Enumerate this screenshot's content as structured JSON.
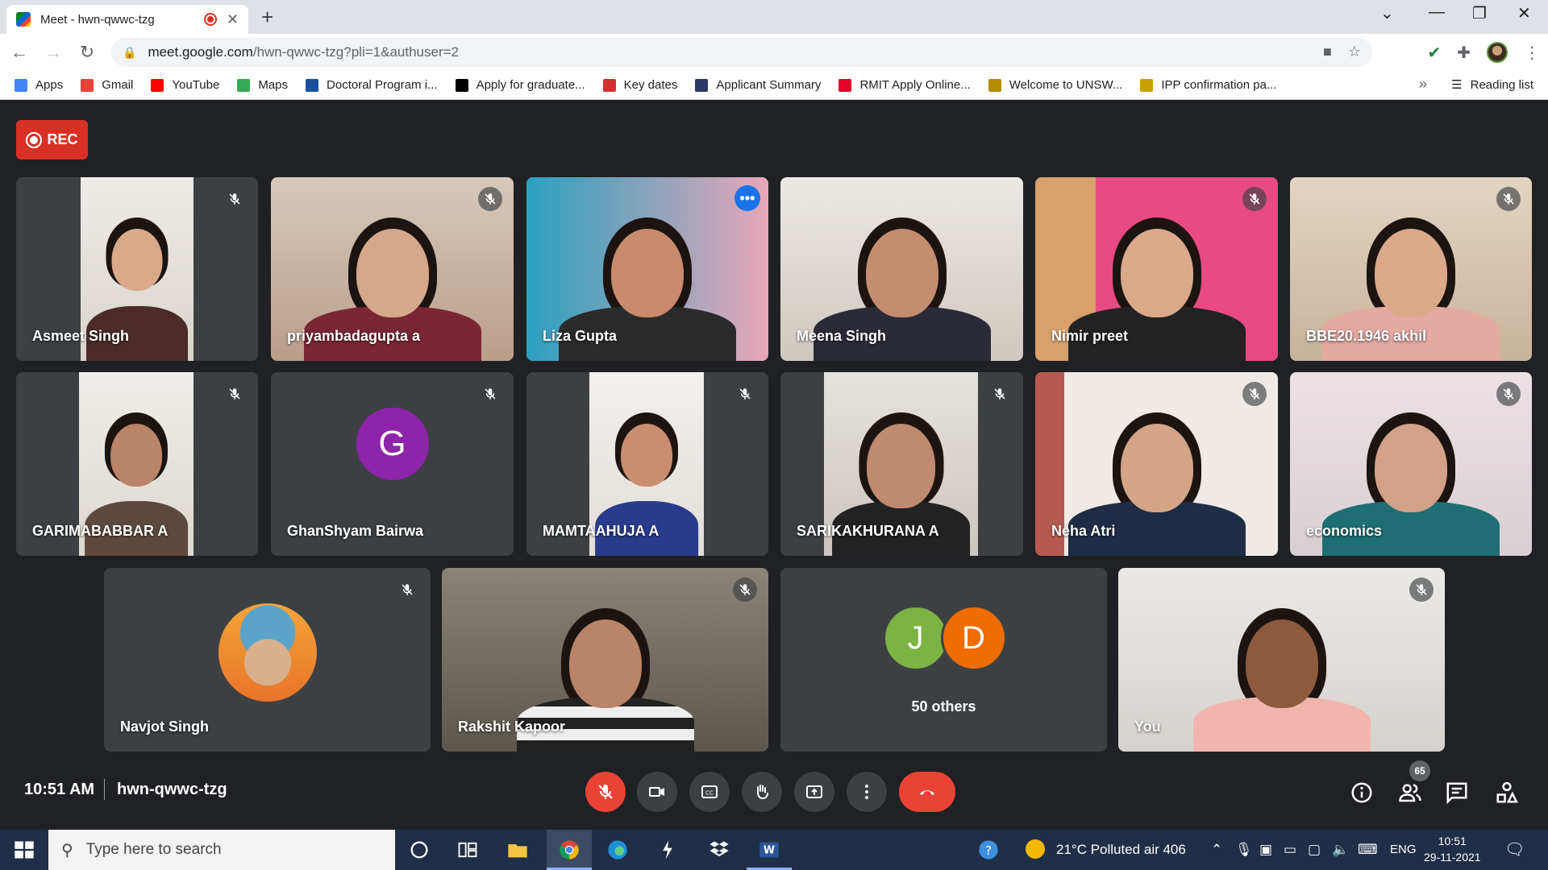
{
  "browser": {
    "tab_title": "Meet - hwn-qwwc-tzg",
    "url_host": "meet.google.com",
    "url_path": "/hwn-qwwc-tzg?pli=1&authuser=2",
    "bookmarks": [
      {
        "label": "Apps",
        "color": "#4285f4"
      },
      {
        "label": "Gmail",
        "color": "#ea4335"
      },
      {
        "label": "YouTube",
        "color": "#ff0000"
      },
      {
        "label": "Maps",
        "color": "#34a853"
      },
      {
        "label": "Doctoral Program i...",
        "color": "#1a4f9c"
      },
      {
        "label": "Apply for graduate...",
        "color": "#000000"
      },
      {
        "label": "Key dates",
        "color": "#d32f2f"
      },
      {
        "label": "Applicant Summary",
        "color": "#2b3a67"
      },
      {
        "label": "RMIT Apply Online...",
        "color": "#e60028"
      },
      {
        "label": "Welcome to UNSW...",
        "color": "#b58b00"
      },
      {
        "label": "IPP confirmation pa...",
        "color": "#c8a000"
      }
    ],
    "reading_list": "Reading list"
  },
  "meet": {
    "rec_label": "REC",
    "participants": [
      {
        "name": "Asmeet Singh"
      },
      {
        "name": "priyambadagupta a"
      },
      {
        "name": "Liza Gupta"
      },
      {
        "name": "Meena Singh"
      },
      {
        "name": "Nimir preet"
      },
      {
        "name": "BBE20.1946 akhil"
      },
      {
        "name": "GARIMABABBAR A"
      },
      {
        "name": "GhanShyam Bairwa",
        "initial": "G"
      },
      {
        "name": "MAMTAAHUJA A"
      },
      {
        "name": "SARIKAKHURANA A"
      },
      {
        "name": "Neha Atri"
      },
      {
        "name": "economics"
      },
      {
        "name": "Navjot Singh"
      },
      {
        "name": "Rakshit Kapoor"
      },
      {
        "name": "50 others",
        "initials": [
          "J",
          "D"
        ]
      },
      {
        "name": "You"
      }
    ],
    "time": "10:51 AM",
    "meeting_code": "hwn-qwwc-tzg",
    "participant_count": "65"
  },
  "taskbar": {
    "search_placeholder": "Type here to search",
    "weather": "21°C  Polluted air 406",
    "lang": "ENG",
    "clock_time": "10:51",
    "clock_date": "29-11-2021"
  }
}
